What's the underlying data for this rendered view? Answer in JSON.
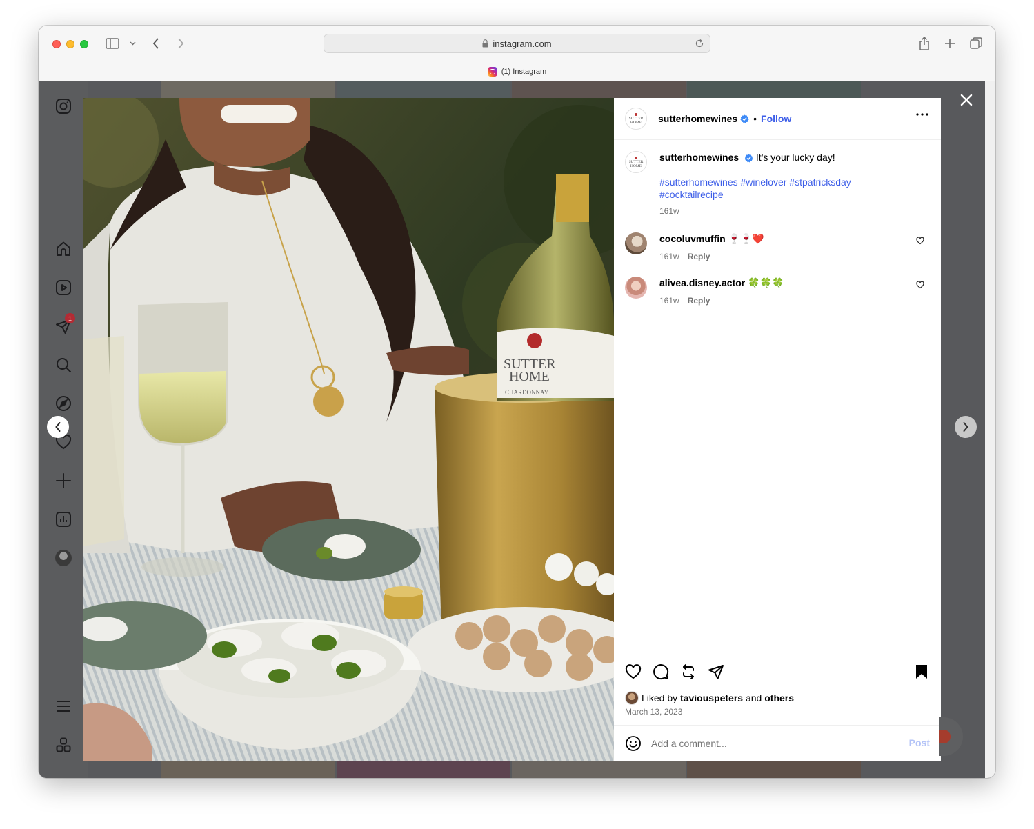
{
  "browser": {
    "url": "instagram.com",
    "tab_title": "(1) Instagram"
  },
  "nav": {
    "notification_count": "1"
  },
  "post": {
    "author": "sutterhomewines",
    "follow_label": "Follow",
    "brand_avatar_text": [
      "SUTTER",
      "HOME"
    ],
    "caption": {
      "username": "sutterhomewines",
      "text": "It's your lucky day!",
      "hashtags": "#sutterhomewines #winelover #stpatricksday #cocktailrecipe",
      "time": "161w"
    },
    "comments": [
      {
        "username": "cocoluvmuffin",
        "text": "🍷🍷❤️",
        "time": "161w",
        "reply_label": "Reply"
      },
      {
        "username": "alivea.disney.actor",
        "text": "🍀🍀🍀",
        "time": "161w",
        "reply_label": "Reply"
      }
    ],
    "likes": {
      "prefix": "Liked by",
      "user": "taviouspeters",
      "conjunction": "and",
      "others": "others"
    },
    "date": "March 13, 2023",
    "comment_input": {
      "placeholder": "Add a comment...",
      "value": "",
      "post_label": "Post"
    }
  },
  "photo": {
    "bottle_label": [
      "SUTTER",
      "HOME"
    ],
    "bottle_variety": "CHARDONNAY"
  },
  "colors": {
    "link": "#3d5ee8",
    "overlay": "#58595c"
  }
}
